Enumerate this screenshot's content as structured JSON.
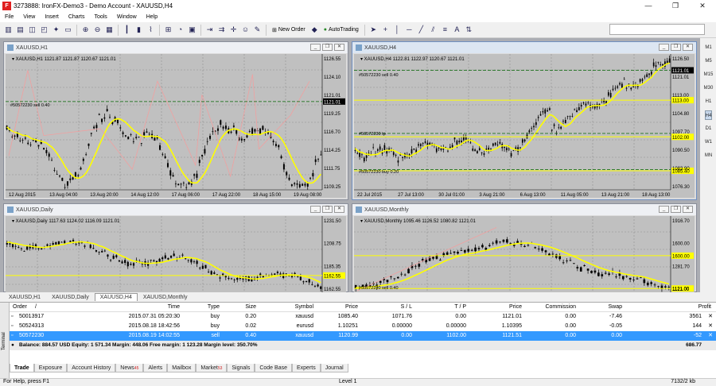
{
  "window": {
    "icon": "F",
    "title": "3273888: IronFX-Demo3 - Demo Account - XAUUSD,H4",
    "controls": [
      "—",
      "❐",
      "✕"
    ]
  },
  "menu": [
    "File",
    "View",
    "Insert",
    "Charts",
    "Tools",
    "Window",
    "Help"
  ],
  "toolbar": {
    "new_order": "New Order",
    "autotrading": "AutoTrading"
  },
  "timeframes": [
    "M1",
    "M5",
    "M15",
    "M30",
    "H1",
    "H4",
    "D1",
    "W1",
    "MN"
  ],
  "selected_timeframe": "H4",
  "charts": {
    "h1": {
      "title": "XAUUSD,H1",
      "ohlc": "XAUUSD,H1  1121.87 1121.87 1120.67 1121.01",
      "order_label": "#50572230 sell 0.40",
      "price_labels": [
        "1126.55",
        "1124.10",
        "1121.01",
        "1119.25",
        "1116.70",
        "1114.25",
        "1111.75",
        "1109.25"
      ],
      "time_labels": [
        "12 Aug 2015",
        "13 Aug 04:00",
        "13 Aug 20:00",
        "14 Aug 12:00",
        "17 Aug 06:00",
        "17 Aug 22:00",
        "18 Aug 15:00",
        "19 Aug 08:00"
      ]
    },
    "h4": {
      "title": "XAUUSD,H4",
      "ohlc": "XAUUSD,H4  1122.81 1122.97 1120.67 1121.01",
      "order_label": "#50572230 sell 0.40",
      "order_label2": "#50572230 tp",
      "order_label3": "#50572230 buy 0.20",
      "price_labels": [
        "1126.50",
        "1121.01",
        "1113.00",
        "1104.80",
        "1097.70",
        "1090.50",
        "1083.90",
        "1076.30"
      ],
      "hl_labels": [
        "1121.01",
        "1113.00",
        "1102.00",
        "1085.40"
      ],
      "time_labels": [
        "22 Jul 2015",
        "27 Jul 13:00",
        "30 Jul 01:00",
        "3 Aug 21:00",
        "6 Aug 13:00",
        "11 Aug 05:00",
        "13 Aug 21:00",
        "18 Aug 13:00"
      ]
    },
    "daily": {
      "title": "XAUUSD,Daily",
      "ohlc": "XAUUSD,Daily  1117.63 1124.02 1116.09 1121.01",
      "price_labels": [
        "1231.50",
        "1208.75",
        "1185.35",
        "1162.55"
      ],
      "hl_label": "1162.55"
    },
    "monthly": {
      "title": "XAUUSD,Monthly",
      "ohlc": "XAUUSD,Monthly  1095.46 1126.52 1080.82 1121.01",
      "order_label": "#50572230 sell 0.40",
      "price_labels": [
        "1916.70",
        "1600.00",
        "1281.70",
        "1121.00"
      ],
      "hl_labels": [
        "1600.00",
        "1121.00"
      ]
    }
  },
  "chart_tabs": [
    "XAUUSD,H1",
    "XAUUSD,Daily",
    "XAUUSD,H4",
    "XAUUSD,Monthly"
  ],
  "selected_chart_tab": "XAUUSD,H4",
  "terminal": {
    "side_label": "Terminal",
    "columns": [
      "Order",
      "/",
      "Time",
      "Type",
      "Size",
      "Symbol",
      "Price",
      "S / L",
      "T / P",
      "Price",
      "Commission",
      "Swap",
      "Profit"
    ],
    "rows": [
      {
        "order": "50013917",
        "time": "2015.07.31 05:20:30",
        "type": "buy",
        "size": "0.20",
        "symbol": "xauusd",
        "price": "1085.40",
        "sl": "1071.76",
        "tp": "0.00",
        "cur_price": "1121.01",
        "commission": "0.00",
        "swap": "-7.46",
        "profit": "3561"
      },
      {
        "order": "50524313",
        "time": "2015.08.18 18:42:56",
        "type": "buy",
        "size": "0.02",
        "symbol": "eurusd",
        "price": "1.10251",
        "sl": "0.00000",
        "tp": "0.00000",
        "cur_price": "1.10395",
        "commission": "0.00",
        "swap": "-0.05",
        "profit": "144"
      },
      {
        "order": "50572230",
        "time": "2015.08.19 14:02:55",
        "type": "sell",
        "size": "0.40",
        "symbol": "xauusd",
        "price": "1120.99",
        "sl": "0.00",
        "tp": "1102.00",
        "cur_price": "1121.51",
        "commission": "0.00",
        "swap": "0.00",
        "profit": "-52"
      }
    ],
    "balance_line": "Balance: 884.57 USD  Equity: 1 571.34  Margin: 448.06  Free margin: 1 123.28  Margin level: 350.70%",
    "balance_total": "686.77",
    "tabs": [
      {
        "label": "Trade",
        "badge": ""
      },
      {
        "label": "Exposure",
        "badge": ""
      },
      {
        "label": "Account History",
        "badge": ""
      },
      {
        "label": "News",
        "badge": "45"
      },
      {
        "label": "Alerts",
        "badge": ""
      },
      {
        "label": "Mailbox",
        "badge": ""
      },
      {
        "label": "Market",
        "badge": "53"
      },
      {
        "label": "Signals",
        "badge": ""
      },
      {
        "label": "Code Base",
        "badge": ""
      },
      {
        "label": "Experts",
        "badge": ""
      },
      {
        "label": "Journal",
        "badge": ""
      }
    ],
    "selected_tab": "Trade"
  },
  "status": {
    "help": "For Help, press F1",
    "level": "Level 1",
    "traffic": "7132/2 kb"
  },
  "colors": {
    "chart_bg": "#c0c0c0",
    "candle": "#000000",
    "ma": "#ffff00",
    "level": "#ffff00",
    "order_line": "#006400",
    "selection": "#3399ff"
  }
}
